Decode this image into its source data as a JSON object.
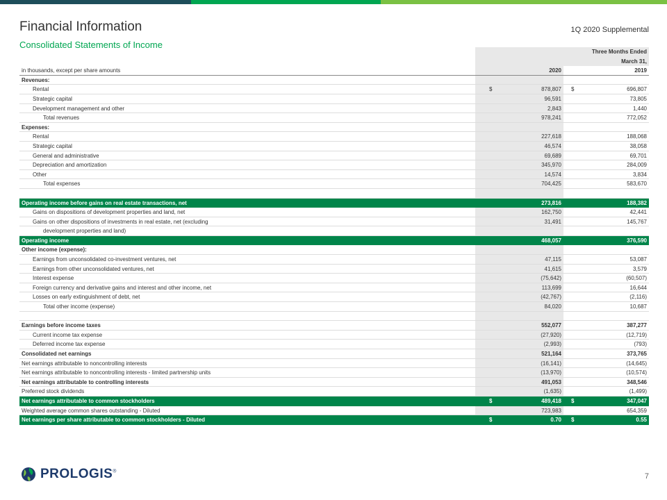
{
  "colors": {
    "bar1": "#1d4e5a",
    "bar2": "#00a651",
    "bar3": "#7ac143",
    "accent": "#00854a",
    "navy": "#1d3a6b"
  },
  "header": {
    "title": "Financial Information",
    "subtitle": "Consolidated Statements of Income",
    "supplemental": "1Q 2020 Supplemental"
  },
  "table": {
    "period_line1": "Three Months Ended",
    "period_line2": "March 31,",
    "units_label": "in thousands, except per share amounts",
    "col1": "2020",
    "col2": "2019",
    "rows": [
      {
        "label": "Revenues:",
        "v1": "",
        "v2": "",
        "cls": "bold"
      },
      {
        "label": "Rental",
        "d": "$",
        "v1": "878,807",
        "v2": "696,807",
        "cls": "i1"
      },
      {
        "label": "Strategic capital",
        "v1": "96,591",
        "v2": "73,805",
        "cls": "i1"
      },
      {
        "label": "Development management and other",
        "v1": "2,843",
        "v2": "1,440",
        "cls": "i1",
        "ul": true
      },
      {
        "label": "Total revenues",
        "v1": "978,241",
        "v2": "772,052",
        "cls": "i2"
      },
      {
        "label": "Expenses:",
        "v1": "",
        "v2": "",
        "cls": "bold"
      },
      {
        "label": "Rental",
        "v1": "227,618",
        "v2": "188,068",
        "cls": "i1"
      },
      {
        "label": "Strategic capital",
        "v1": "46,574",
        "v2": "38,058",
        "cls": "i1"
      },
      {
        "label": "General and administrative",
        "v1": "69,689",
        "v2": "69,701",
        "cls": "i1"
      },
      {
        "label": "Depreciation and amortization",
        "v1": "345,970",
        "v2": "284,009",
        "cls": "i1"
      },
      {
        "label": "Other",
        "v1": "14,574",
        "v2": "3,834",
        "cls": "i1",
        "ul": true
      },
      {
        "label": "Total expenses",
        "v1": "704,425",
        "v2": "583,670",
        "cls": "i2",
        "ul": true
      },
      {
        "label": "",
        "v1": "",
        "v2": "",
        "cls": ""
      },
      {
        "label": "Operating income before gains on real estate transactions, net",
        "v1": "273,816",
        "v2": "188,382",
        "cls": "hl"
      },
      {
        "label": "Gains on dispositions of development properties and land, net",
        "v1": "162,750",
        "v2": "42,441",
        "cls": "i1"
      },
      {
        "label": "Gains on other dispositions of investments in real estate, net (excluding",
        "v1": "31,491",
        "v2": "145,767",
        "cls": "i1"
      },
      {
        "label": "development properties and land)",
        "v1": "",
        "v2": "",
        "cls": "i2"
      },
      {
        "label": "Operating income",
        "v1": "468,057",
        "v2": "376,590",
        "cls": "hl"
      },
      {
        "label": "Other income (expense):",
        "v1": "",
        "v2": "",
        "cls": "bold"
      },
      {
        "label": "Earnings from unconsolidated co-investment ventures, net",
        "v1": "47,115",
        "v2": "53,087",
        "cls": "i1"
      },
      {
        "label": "Earnings from other unconsolidated ventures, net",
        "v1": "41,615",
        "v2": "3,579",
        "cls": "i1"
      },
      {
        "label": "Interest expense",
        "v1": "(75,642)",
        "v2": "(60,507)",
        "cls": "i1"
      },
      {
        "label": "Foreign currency and derivative gains and interest and other income, net",
        "v1": "113,699",
        "v2": "16,644",
        "cls": "i1"
      },
      {
        "label": "Losses on early extinguishment of debt, net",
        "v1": "(42,767)",
        "v2": "(2,116)",
        "cls": "i1",
        "ul": true
      },
      {
        "label": "Total other income (expense)",
        "v1": "84,020",
        "v2": "10,687",
        "cls": "i2"
      },
      {
        "label": "",
        "v1": "",
        "v2": "",
        "cls": ""
      },
      {
        "label": "Earnings before income taxes",
        "v1": "552,077",
        "v2": "387,277",
        "cls": "bold"
      },
      {
        "label": "Current income tax expense",
        "v1": "(27,920)",
        "v2": "(12,719)",
        "cls": "i1"
      },
      {
        "label": "Deferred income tax expense",
        "v1": "(2,993)",
        "v2": "(793)",
        "cls": "i1",
        "ul": true
      },
      {
        "label": "Consolidated net earnings",
        "v1": "521,164",
        "v2": "373,765",
        "cls": "bold"
      },
      {
        "label": "Net earnings attributable to noncontrolling interests",
        "v1": "(16,141)",
        "v2": "(14,645)",
        "cls": ""
      },
      {
        "label": "Net earnings attributable to noncontrolling interests - limited partnership units",
        "v1": "(13,970)",
        "v2": "(10,574)",
        "cls": "",
        "ul": true
      },
      {
        "label": "Net earnings attributable to controlling interests",
        "v1": "491,053",
        "v2": "348,546",
        "cls": "bold"
      },
      {
        "label": "Preferred stock dividends",
        "v1": "(1,635)",
        "v2": "(1,499)",
        "cls": ""
      },
      {
        "label": "Net earnings attributable to common stockholders",
        "d": "$",
        "v1": "489,418",
        "v2": "347,047",
        "cls": "hl"
      },
      {
        "label": "Weighted average common shares outstanding - Diluted",
        "v1": "723,983",
        "v2": "654,359",
        "cls": ""
      },
      {
        "label": "Net earnings per share attributable to common stockholders - Diluted",
        "d": "$",
        "v1": "0.70",
        "v2": "0.55",
        "cls": "hl"
      }
    ]
  },
  "footer": {
    "logo_text": "PROLOGIS",
    "logo_mark": "®",
    "page_number": "7"
  }
}
